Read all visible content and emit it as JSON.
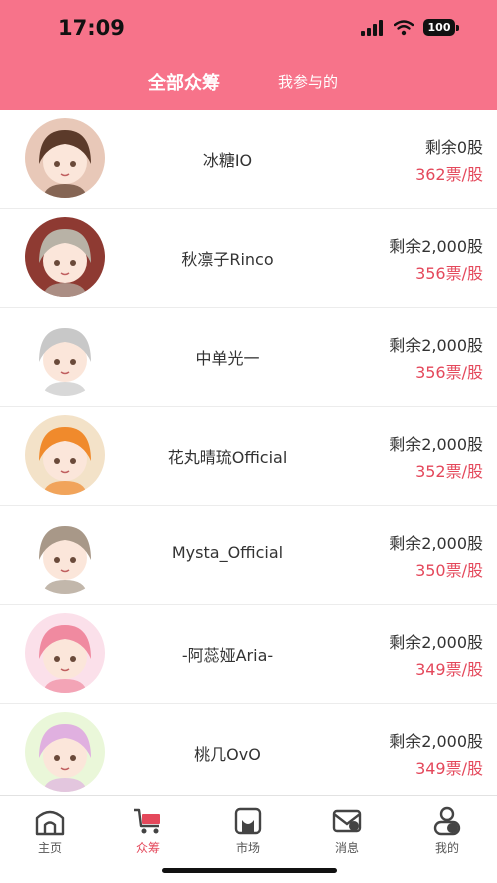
{
  "status_bar": {
    "time": "17:09",
    "battery": "100"
  },
  "tabs": {
    "all": "全部众筹",
    "mine": "我参与的"
  },
  "items": [
    {
      "name": "冰糖IO",
      "remaining": "剩余0股",
      "price": "362票/股",
      "hair": "#5b3a2a",
      "bg": "#e8c8b8"
    },
    {
      "name": "秋凛子Rinco",
      "remaining": "剩余2,000股",
      "price": "356票/股",
      "hair": "#b8b2a6",
      "bg": "#8e3a32"
    },
    {
      "name": "中单光一",
      "remaining": "剩余2,000股",
      "price": "356票/股",
      "hair": "#c8c8c8",
      "bg": "#ffffff"
    },
    {
      "name": "花丸晴琉Official",
      "remaining": "剩余2,000股",
      "price": "352票/股",
      "hair": "#f08a2c",
      "bg": "#f3e2c8"
    },
    {
      "name": "Mysta_Official",
      "remaining": "剩余2,000股",
      "price": "350票/股",
      "hair": "#a89888",
      "bg": "#ffffff"
    },
    {
      "name": "-阿蕊娅Aria-",
      "remaining": "剩余2,000股",
      "price": "349票/股",
      "hair": "#f08aa0",
      "bg": "#fbe0ea"
    },
    {
      "name": "桃几OvO",
      "remaining": "剩余2,000股",
      "price": "349票/股",
      "hair": "#e0b0e0",
      "bg": "#eaf7d9"
    }
  ],
  "nav": [
    {
      "label": "主页",
      "icon": "home-icon"
    },
    {
      "label": "众筹",
      "icon": "cart-icon"
    },
    {
      "label": "市场",
      "icon": "market-icon"
    },
    {
      "label": "消息",
      "icon": "mail-icon"
    },
    {
      "label": "我的",
      "icon": "profile-icon"
    }
  ],
  "colors": {
    "header": "#f7738a",
    "price": "#e4485b",
    "active_nav": "#e4485b"
  }
}
